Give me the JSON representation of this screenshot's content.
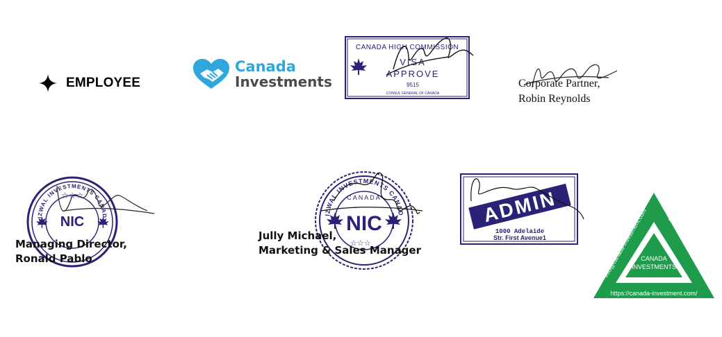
{
  "employee_badge": {
    "label": "EMPLOYEE",
    "icon": "sparkle-icon"
  },
  "canada_investments_logo": {
    "word1": "Canada",
    "word2": "Investments",
    "icon": "handshake-heart-icon",
    "color_primary": "#2fa7dc",
    "color_secondary": "#4a4a4a"
  },
  "visa_stamp": {
    "top_text": "CANADA HIGH COMMISSION",
    "line1": "VISA",
    "line2": "APPROVE",
    "number": "9515",
    "footer": "CONSUL GENERAL OF CANADA",
    "color": "#2a2276"
  },
  "corporate_partner": {
    "title": "Corporate Partner,",
    "name": "Robin Reynolds"
  },
  "nic_stamp_1": {
    "ring_text": "NIZWAL INVESTMENTS CANADA",
    "center": "NIC",
    "caption_title": "Managing Director,",
    "caption_name": "Ronald Pablo"
  },
  "nic_stamp_2": {
    "ring_text": "NIZWAL INVESTMENTS CANADA",
    "sub": "CANADA",
    "center": "NIC",
    "caption_name": "Jully Michael,",
    "caption_title": "Marketing & Sales Manager"
  },
  "admin_stamp": {
    "label": "ADMIN",
    "line1": "1000 Adelaide",
    "line2": "Str. First Avenue1",
    "color": "#2a2276"
  },
  "triangle_seal": {
    "line1": "CANADA",
    "line2": "INVESTMENTS",
    "edge_right": "info@canada-investment.com",
    "edge_left": "info@canada-investment.com",
    "bottom": "https://canada-investment.com/",
    "color": "#1e9c4c"
  }
}
